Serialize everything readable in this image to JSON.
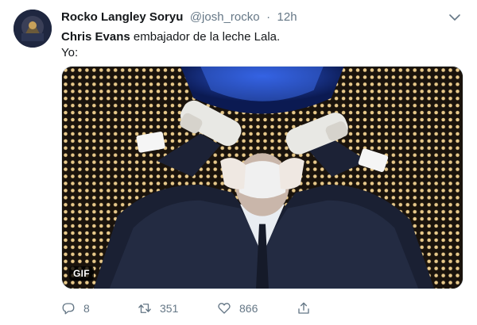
{
  "tweet": {
    "display_name": "Rocko Langley Soryu",
    "handle": "@josh_rocko",
    "separator": "·",
    "time": "12h",
    "mention": "Chris Evans",
    "text_after_mention": " embajador de la leche Lala.",
    "text_line2": "Yo:",
    "media_badge": "GIF"
  },
  "actions": {
    "reply_count": "8",
    "retweet_count": "351",
    "like_count": "866"
  },
  "icons": {
    "reply": "reply-icon",
    "retweet": "retweet-icon",
    "like": "heart-icon",
    "share": "share-icon",
    "menu": "chevron-down-icon"
  },
  "colors": {
    "text": "#14171a",
    "muted": "#657786",
    "border": "#e1e8ed"
  }
}
